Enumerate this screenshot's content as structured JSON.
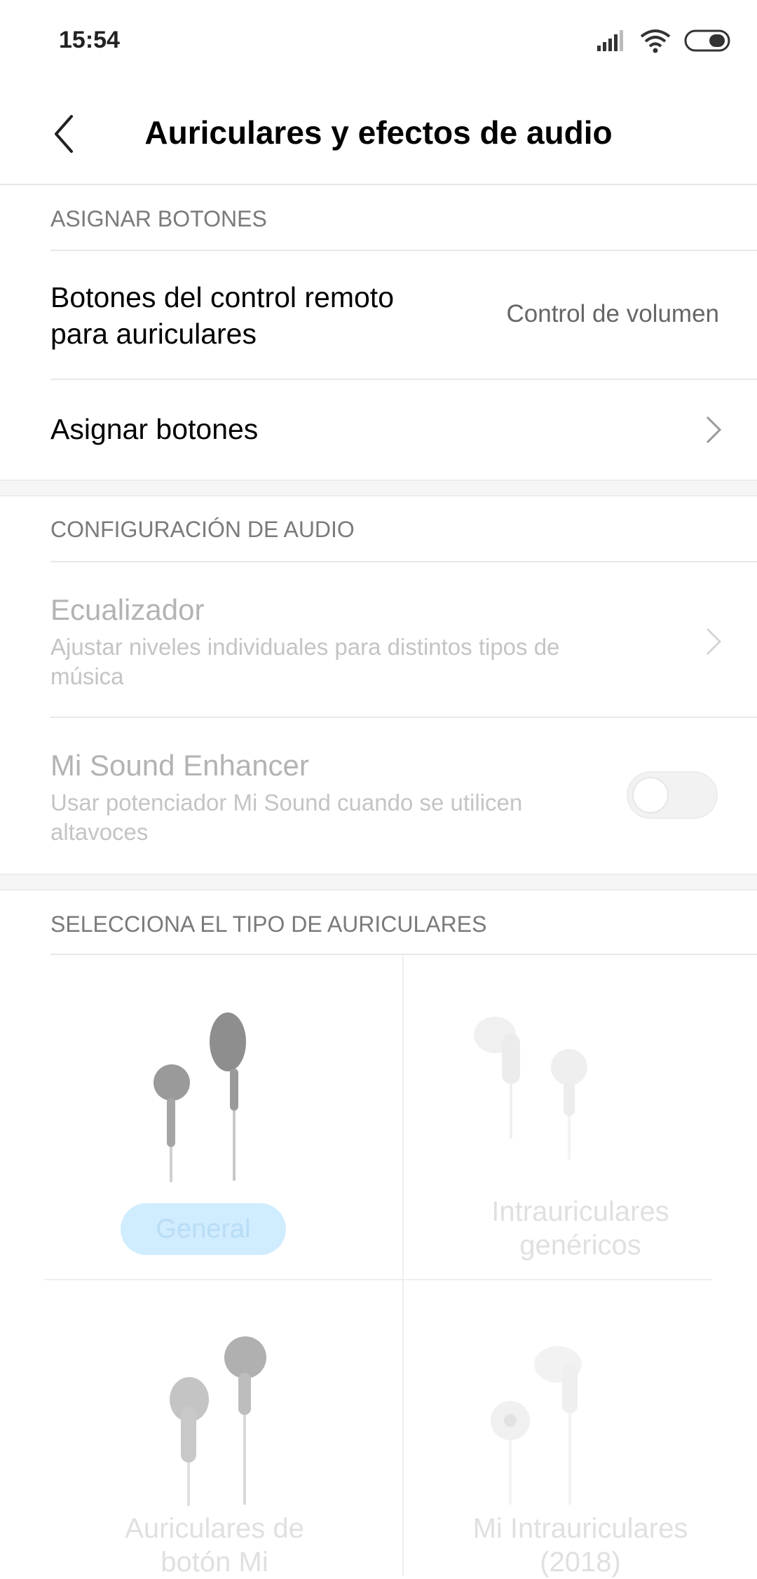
{
  "status": {
    "time": "15:54"
  },
  "header": {
    "title": "Auriculares y efectos de audio"
  },
  "sections": {
    "buttons": {
      "heading": "ASIGNAR BOTONES",
      "remote_title_l1": "Botones del control remoto",
      "remote_title_l2": "para auriculares",
      "remote_value": "Control de volumen",
      "assign_title": "Asignar botones"
    },
    "audio": {
      "heading": "CONFIGURACIÓN DE AUDIO",
      "eq_title": "Ecualizador",
      "eq_sub_l1": "Ajustar niveles individuales para distintos tipos de",
      "eq_sub_l2": "música",
      "enhancer_title": "Mi Sound Enhancer",
      "enhancer_sub_l1": "Usar potenciador Mi Sound cuando se utilicen",
      "enhancer_sub_l2": "altavoces",
      "enhancer_on": false
    },
    "headphones": {
      "heading": "SELECCIONA EL TIPO DE AURICULARES",
      "items": [
        {
          "label": "General",
          "selected": true
        },
        {
          "label_l1": "Intrauriculares",
          "label_l2": "genéricos"
        },
        {
          "label_l1": "Auriculares de",
          "label_l2": "botón Mi"
        },
        {
          "label_l1": "Mi Intrauriculares",
          "label_l2": "(2018)"
        }
      ]
    }
  },
  "colors": {
    "accent_light": "#d0ecff",
    "disabled_text": "#b3b3b3"
  }
}
